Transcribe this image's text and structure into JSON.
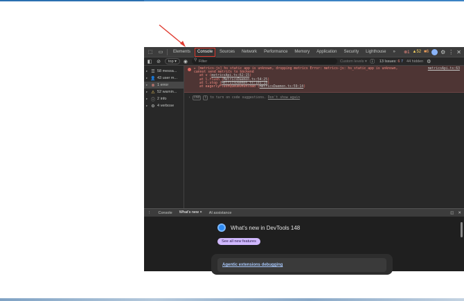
{
  "tabbar": {
    "tabs": [
      {
        "label": "Elements",
        "active": false
      },
      {
        "label": "Console",
        "active": true
      },
      {
        "label": "Sources",
        "active": false
      },
      {
        "label": "Network",
        "active": false
      },
      {
        "label": "Performance",
        "active": false
      },
      {
        "label": "Memory",
        "active": false
      },
      {
        "label": "Application",
        "active": false
      },
      {
        "label": "Security",
        "active": false
      },
      {
        "label": "Lighthouse",
        "active": false
      }
    ],
    "more": "»",
    "errors": "1",
    "warnings": "52",
    "infos": "6"
  },
  "toolbar": {
    "context": "top ▾",
    "filter_placeholder": "Filter",
    "levels": "Custom levels ▾",
    "issues": "13 Issues:",
    "issues_err": "6",
    "issues_info": "7",
    "hidden": "44 hidden"
  },
  "sidebar": {
    "items": [
      {
        "icon": "☰",
        "label": "58 messa..."
      },
      {
        "icon": "👤",
        "label": "43 user m..."
      },
      {
        "icon": "⊗",
        "label": "1 error"
      },
      {
        "icon": "⚠",
        "label": "52 warnin..."
      },
      {
        "icon": "ⓘ",
        "label": "2 info"
      },
      {
        "icon": "⚙",
        "label": "4 verbose"
      }
    ]
  },
  "console": {
    "error_line1": "▸ [metrics-js] hs_static_app is unknown, dropping metrics Error: metrics-js: hs_static_app is unknown,",
    "error_line2": "cannot send metrics to backend",
    "error_source": "metricsApi.ts:63",
    "stack": [
      {
        "prefix": "at v (",
        "link": "metricsApi.ts:62:15",
        "suffix": ")"
      },
      {
        "prefix": "at l.flush (",
        "link": "MetricsDaemon.ts:54:25",
        "suffix": ")"
      },
      {
        "prefix": "at l.stop (",
        "link": "MetricsDaemon.ts:103:18",
        "suffix": ")"
      },
      {
        "prefix": "at eagerlyFlushQueueOnUnload (",
        "link": "MetricsDaemon.ts:59:14",
        "suffix": ")"
      }
    ],
    "hint_cmd": "cmd",
    "hint_i": "i",
    "hint_text": "to turn on code suggestions.",
    "hint_dismiss": "Don't show again"
  },
  "drawer": {
    "tabs": [
      {
        "label": "Console",
        "active": false
      },
      {
        "label": "What's new ×",
        "active": true
      },
      {
        "label": "AI assistance",
        "active": false
      }
    ]
  },
  "whatsnew": {
    "title": "What's new in DevTools 148",
    "button": "See all new features",
    "card_title": "Agentic extensions debugging"
  }
}
